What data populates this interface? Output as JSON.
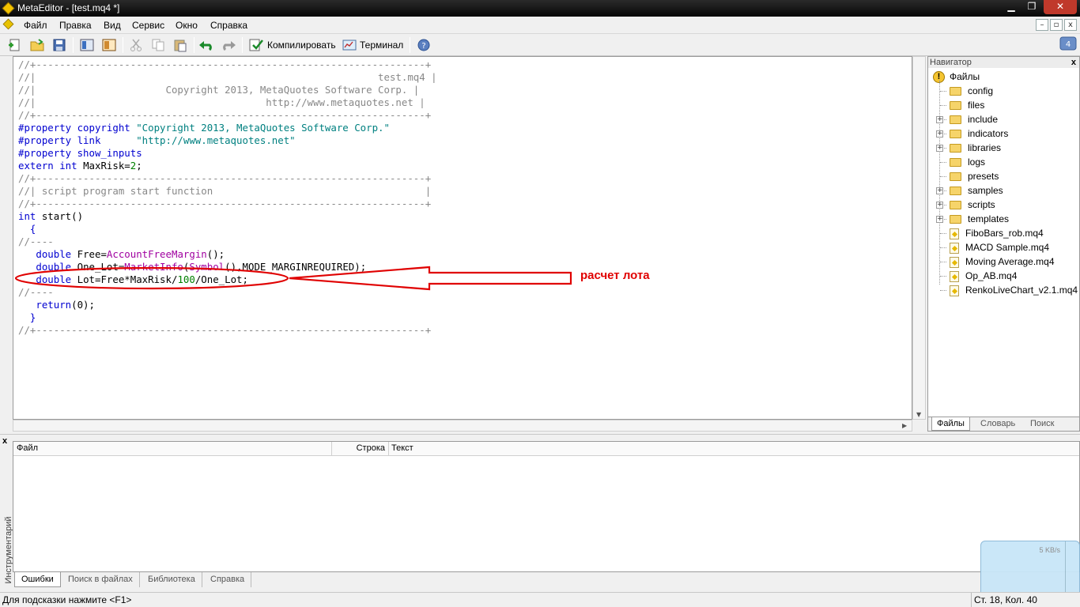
{
  "window": {
    "title": "MetaEditor - [test.mq4 *]",
    "minimize": "▁",
    "restore": "❐",
    "close": "✕"
  },
  "menu": {
    "items": [
      "Файл",
      "Правка",
      "Вид",
      "Сервис",
      "Окно",
      "Справка"
    ],
    "mdi_minimize": "–",
    "mdi_restore": "▫",
    "mdi_close": "x"
  },
  "toolbar": {
    "compile_label": "Компилировать",
    "terminal_label": "Терминал",
    "icons": [
      "new-file-icon",
      "open-folder-icon",
      "save-icon",
      "navigator-toggle-icon",
      "toolbox-toggle-icon",
      "cut-icon",
      "copy-icon",
      "paste-icon",
      "undo-icon",
      "redo-icon",
      "compile-icon",
      "terminal-icon",
      "help-icon"
    ]
  },
  "editor": {
    "lines": [
      [
        {
          "t": "//+------------------------------------------------------------------+",
          "c": "com"
        }
      ],
      [
        {
          "t": "//|                                                          test.mq4 |",
          "c": "com"
        }
      ],
      [
        {
          "t": "//|                      Copyright 2013, MetaQuotes Software Corp. |",
          "c": "com"
        }
      ],
      [
        {
          "t": "//|                                       http://www.metaquotes.net |",
          "c": "com"
        }
      ],
      [
        {
          "t": "//+------------------------------------------------------------------+",
          "c": "com"
        }
      ],
      [
        {
          "t": "#property copyright ",
          "c": "kw"
        },
        {
          "t": "\"Copyright 2013, MetaQuotes Software Corp.\"",
          "c": "str"
        }
      ],
      [
        {
          "t": "#property link      ",
          "c": "kw"
        },
        {
          "t": "\"http://www.metaquotes.net\"",
          "c": "str"
        }
      ],
      [
        {
          "t": "#property show_inputs",
          "c": "kw"
        }
      ],
      [
        {
          "t": "extern int ",
          "c": "kw"
        },
        {
          "t": "MaxRisk=",
          "c": ""
        },
        {
          "t": "2",
          "c": "num"
        },
        {
          "t": ";",
          "c": ""
        }
      ],
      [
        {
          "t": "//+------------------------------------------------------------------+",
          "c": "com"
        }
      ],
      [
        {
          "t": "//| script program start function                                    |",
          "c": "com"
        }
      ],
      [
        {
          "t": "//+------------------------------------------------------------------+",
          "c": "com"
        }
      ],
      [
        {
          "t": "int ",
          "c": "kw"
        },
        {
          "t": "start()",
          "c": ""
        }
      ],
      [
        {
          "t": "  {",
          "c": "kw"
        }
      ],
      [
        {
          "t": "//----",
          "c": "com"
        }
      ],
      [
        {
          "t": "   double ",
          "c": "kw"
        },
        {
          "t": "Free=",
          "c": ""
        },
        {
          "t": "AccountFreeMargin",
          "c": "fn"
        },
        {
          "t": "();",
          "c": ""
        }
      ],
      [
        {
          "t": "   double ",
          "c": "kw"
        },
        {
          "t": "One_Lot=",
          "c": ""
        },
        {
          "t": "MarketInfo",
          "c": "fn"
        },
        {
          "t": "(",
          "c": ""
        },
        {
          "t": "Symbol",
          "c": "fn"
        },
        {
          "t": "(),MODE_MARGINREQUIRED);",
          "c": ""
        }
      ],
      [
        {
          "t": "   double ",
          "c": "kw"
        },
        {
          "t": "Lot=Free*MaxRisk/",
          "c": ""
        },
        {
          "t": "100",
          "c": "num"
        },
        {
          "t": "/One_Lot;",
          "c": ""
        }
      ],
      [
        {
          "t": "//----",
          "c": "com"
        }
      ],
      [
        {
          "t": "   return",
          "c": "kw"
        },
        {
          "t": "(0);",
          "c": ""
        }
      ],
      [
        {
          "t": "  }",
          "c": "kw"
        }
      ],
      [
        {
          "t": "//+------------------------------------------------------------------+",
          "c": "com"
        }
      ]
    ],
    "annotation_label": "расчет лота"
  },
  "navigator": {
    "title": "Навигатор",
    "close": "x",
    "root": "Файлы",
    "folders": [
      {
        "name": "config",
        "expandable": false
      },
      {
        "name": "files",
        "expandable": false
      },
      {
        "name": "include",
        "expandable": true
      },
      {
        "name": "indicators",
        "expandable": true
      },
      {
        "name": "libraries",
        "expandable": true
      },
      {
        "name": "logs",
        "expandable": false
      },
      {
        "name": "presets",
        "expandable": false
      },
      {
        "name": "samples",
        "expandable": true
      },
      {
        "name": "scripts",
        "expandable": true
      },
      {
        "name": "templates",
        "expandable": true
      }
    ],
    "files": [
      "FiboBars_rob.mq4",
      "MACD Sample.mq4",
      "Moving Average.mq4",
      "Op_AB.mq4",
      "RenkoLiveChart_v2.1.mq4"
    ],
    "tabs": [
      "Файлы",
      "Словарь",
      "Поиск"
    ]
  },
  "toolbox": {
    "title": "Инструментарий",
    "close": "x",
    "columns": [
      "Файл",
      "Строка",
      "Текст"
    ],
    "tabs": [
      "Ошибки",
      "Поиск в файлах",
      "Библиотека",
      "Справка"
    ]
  },
  "status": {
    "hint": "Для подсказки нажмите <F1>",
    "position": "Ст. 18, Кол. 40"
  },
  "net_widget": {
    "rate": "5 KB/s"
  },
  "colors": {
    "keyword": "#0000d0",
    "string": "#008080",
    "comment": "#888888",
    "function": "#a000a0",
    "number": "#008000",
    "annotation": "#e00000"
  }
}
